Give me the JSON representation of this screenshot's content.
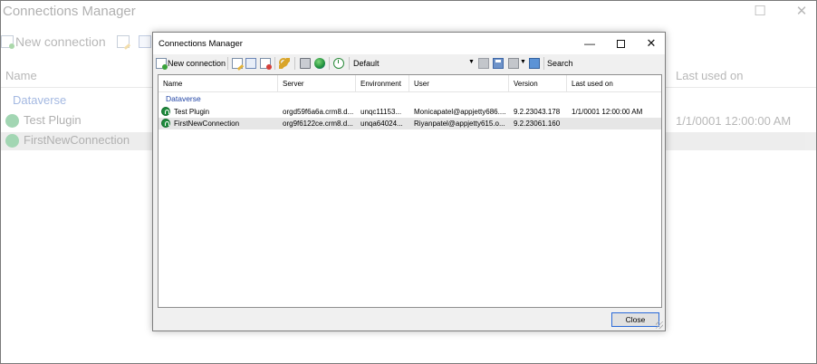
{
  "background_window": {
    "title": "Connections Manager",
    "toolbar_new_label": "New connection",
    "headers": {
      "name": "Name",
      "last_used": "Last used on"
    },
    "group": "Dataverse",
    "rows": [
      {
        "name": "Test Plugin",
        "last_used": "1/1/0001 12:00:00 AM"
      },
      {
        "name": "FirstNewConnection",
        "last_used": ""
      }
    ]
  },
  "dialog": {
    "title": "Connections Manager",
    "window_buttons": {
      "minimize": "—",
      "close": "✕"
    },
    "toolbar": {
      "new_connection": "New connection",
      "environment_selected": "Default",
      "search_label": "Search"
    },
    "columns": [
      "Name",
      "Server",
      "Environment",
      "User",
      "Version",
      "Last used on"
    ],
    "group": "Dataverse",
    "rows": [
      {
        "name": "Test Plugin",
        "server": "orgd59f6a6a.crm8.d...",
        "environment": "unqc11153...",
        "user": "Monicapatel@appjetty686....",
        "version": "9.2.23043.178",
        "last_used": "1/1/0001 12:00:00 AM"
      },
      {
        "name": "FirstNewConnection",
        "server": "org9f6122ce.crm8.d...",
        "environment": "unqa64024...",
        "user": "Riyanpatel@appjetty615.o...",
        "version": "9.2.23061.160",
        "last_used": ""
      }
    ],
    "close_button": "Close"
  },
  "colors": {
    "group_label": "#2346a6",
    "connection_icon": "#1e8a3c",
    "selected_row": "#e6e6e6",
    "dialog_bg": "#f0f0f0",
    "close_button_border": "#2b6ad8"
  },
  "icons": {
    "toolbar": [
      "add-connection-icon",
      "edit-connection-icon",
      "copy-connection-icon",
      "delete-connection-icon",
      "key-icon",
      "drive-icon",
      "globe-icon",
      "refresh-icon",
      "import-icon",
      "save-icon",
      "duplicate-icon",
      "export-icon"
    ],
    "row": "dataverse-connection-icon"
  }
}
